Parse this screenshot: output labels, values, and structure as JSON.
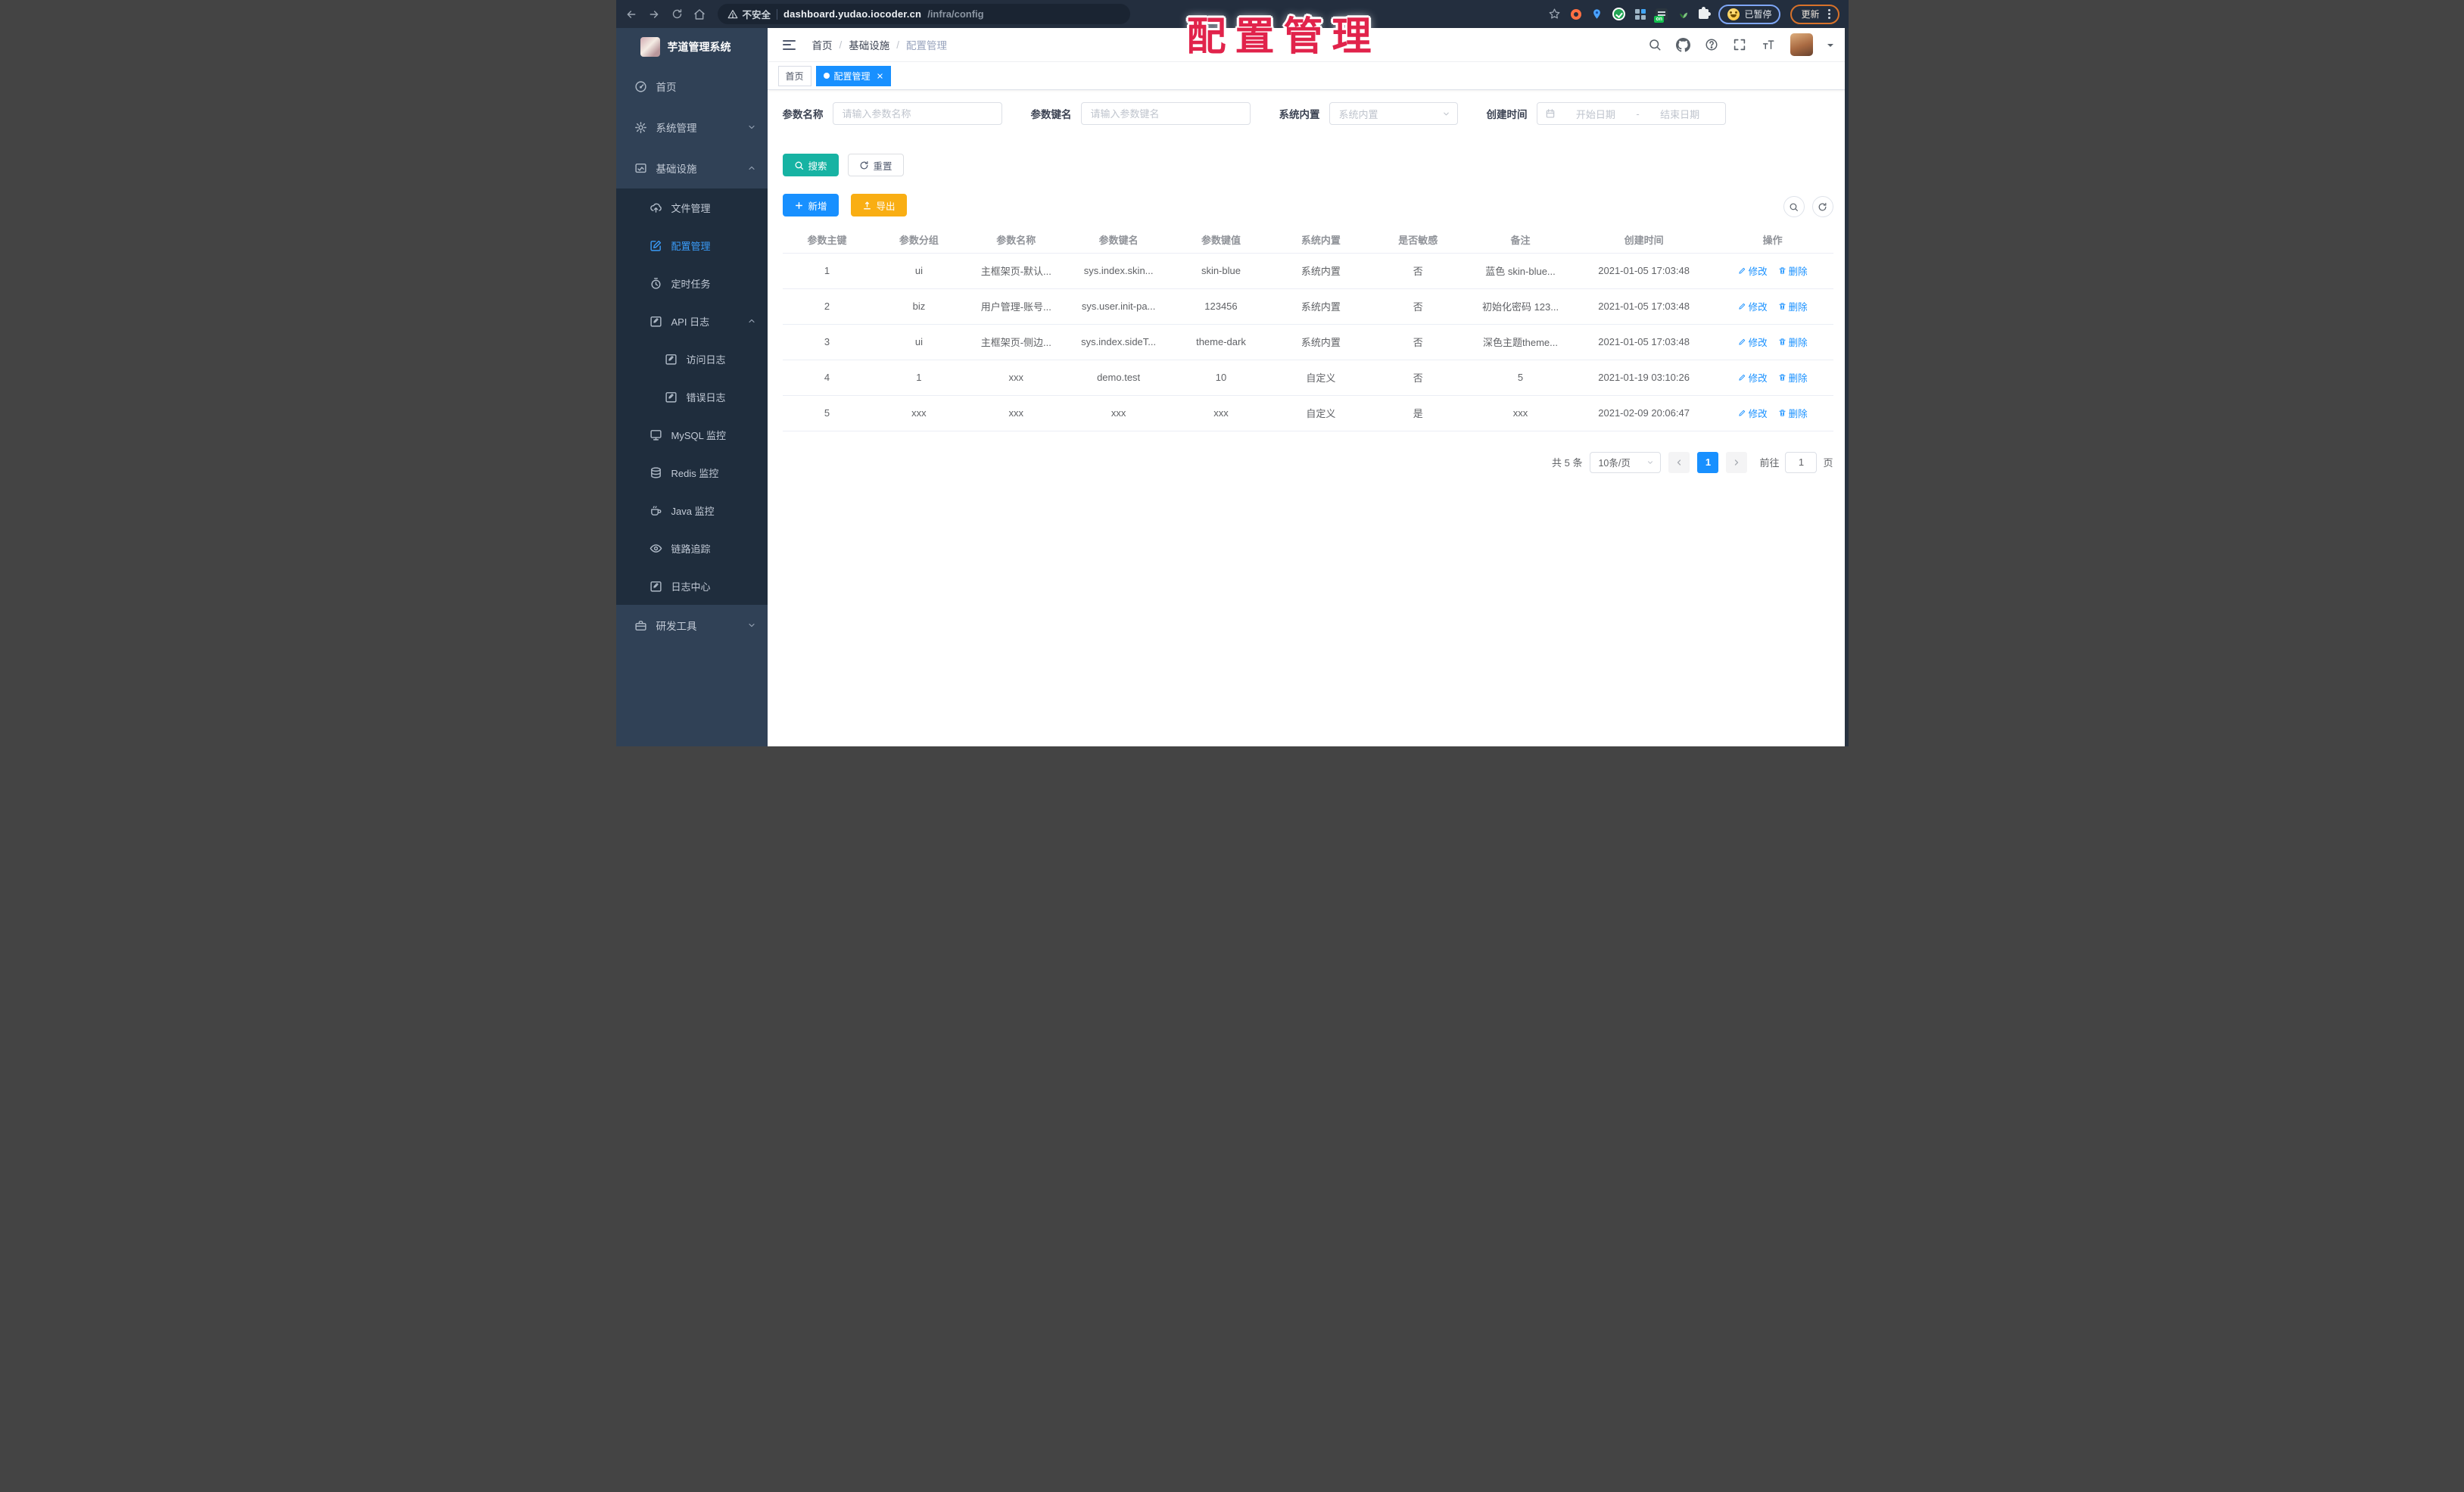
{
  "overlay_title": "配置管理",
  "browser": {
    "insecure_label": "不安全",
    "url_host": "dashboard.yudao.iocoder.cn",
    "url_path": "/infra/config",
    "extension_badge": "on",
    "paused_label": "已暂停",
    "update_label": "更新"
  },
  "sidebar": {
    "app_title": "芋道管理系统",
    "items": {
      "home": "首页",
      "system": "系统管理",
      "infra": "基础设施",
      "file": "文件管理",
      "config": "配置管理",
      "job": "定时任务",
      "api_log": "API 日志",
      "access_log": "访问日志",
      "error_log": "错误日志",
      "mysql": "MySQL 监控",
      "redis": "Redis 监控",
      "java": "Java 监控",
      "trace": "链路追踪",
      "log_center": "日志中心",
      "dev_tools": "研发工具"
    }
  },
  "breadcrumb": {
    "items": [
      "首页",
      "基础设施",
      "配置管理"
    ],
    "separator": "/"
  },
  "tags": {
    "home": "首页",
    "active": "配置管理"
  },
  "filters": {
    "name_label": "参数名称",
    "name_placeholder": "请输入参数名称",
    "key_label": "参数键名",
    "key_placeholder": "请输入参数键名",
    "type_label": "系统内置",
    "type_placeholder": "系统内置",
    "date_label": "创建时间",
    "date_start_placeholder": "开始日期",
    "date_separator": "-",
    "date_end_placeholder": "结束日期",
    "search_button": "搜索",
    "reset_button": "重置"
  },
  "toolbar": {
    "add_button": "新增",
    "export_button": "导出"
  },
  "table": {
    "columns": [
      "参数主键",
      "参数分组",
      "参数名称",
      "参数键名",
      "参数键值",
      "系统内置",
      "是否敏感",
      "备注",
      "创建时间",
      "操作"
    ],
    "edit_label": "修改",
    "delete_label": "删除",
    "rows": [
      {
        "id": "1",
        "group": "ui",
        "name": "主框架页-默认...",
        "key": "sys.index.skin...",
        "value": "skin-blue",
        "type": "系统内置",
        "sensitive": "否",
        "remark": "蓝色 skin-blue...",
        "time": "2021-01-05 17:03:48"
      },
      {
        "id": "2",
        "group": "biz",
        "name": "用户管理-账号...",
        "key": "sys.user.init-pa...",
        "value": "123456",
        "type": "系统内置",
        "sensitive": "否",
        "remark": "初始化密码 123...",
        "time": "2021-01-05 17:03:48"
      },
      {
        "id": "3",
        "group": "ui",
        "name": "主框架页-侧边...",
        "key": "sys.index.sideT...",
        "value": "theme-dark",
        "type": "系统内置",
        "sensitive": "否",
        "remark": "深色主题theme...",
        "time": "2021-01-05 17:03:48"
      },
      {
        "id": "4",
        "group": "1",
        "name": "xxx",
        "key": "demo.test",
        "value": "10",
        "type": "自定义",
        "sensitive": "否",
        "remark": "5",
        "time": "2021-01-19 03:10:26"
      },
      {
        "id": "5",
        "group": "xxx",
        "name": "xxx",
        "key": "xxx",
        "value": "xxx",
        "type": "自定义",
        "sensitive": "是",
        "remark": "xxx",
        "time": "2021-02-09 20:06:47"
      }
    ]
  },
  "pagination": {
    "total": "共 5 条",
    "page_size": "10条/页",
    "current_page": "1",
    "goto_label": "前往",
    "goto_value": "1",
    "page_unit": "页"
  },
  "colors": {
    "accent": "#1890ff",
    "search_teal": "#17b3a3",
    "export_amber": "#f9ae13",
    "overlay_red": "#e1234b",
    "sidebar_bg": "#304156"
  }
}
